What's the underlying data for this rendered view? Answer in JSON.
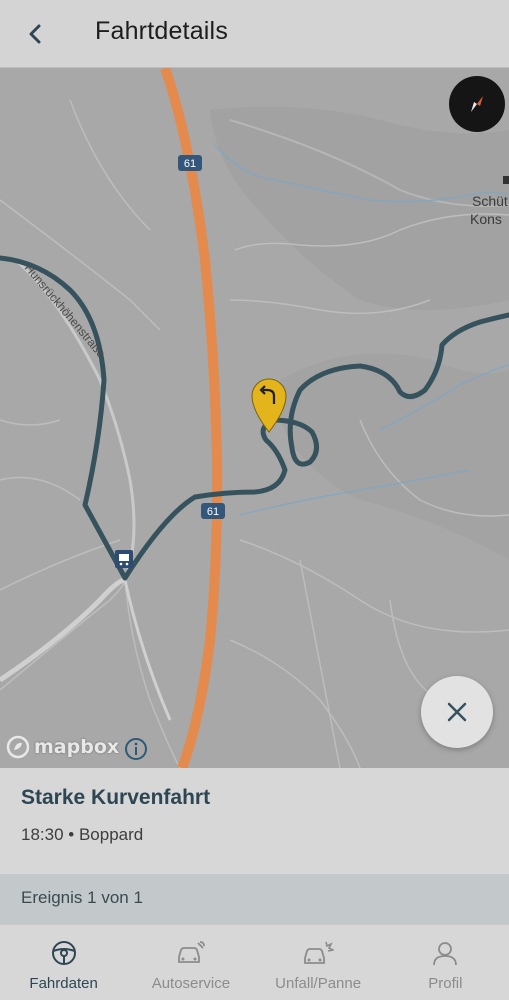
{
  "header": {
    "title": "Fahrtdetails"
  },
  "map": {
    "highway_shield": "61",
    "place_label_line1": "Schüt",
    "place_label_line2": "Kons",
    "street_label": "Hunsrückhöhenstraße",
    "attribution": "mapbox",
    "route_color": "#36525c",
    "highway_color": "#e38a4c",
    "marker_color": "#e3b41c"
  },
  "event": {
    "title": "Starke Kurvenfahrt",
    "meta": "18:30 • Boppard",
    "count_label": "Ereignis 1 von 1"
  },
  "nav": {
    "items": [
      {
        "label": "Fahrdaten",
        "icon": "steering-wheel-icon",
        "active": true
      },
      {
        "label": "Autoservice",
        "icon": "car-wrench-icon",
        "active": false
      },
      {
        "label": "Unfall/Panne",
        "icon": "car-crash-icon",
        "active": false
      },
      {
        "label": "Profil",
        "icon": "person-icon",
        "active": false
      }
    ]
  }
}
